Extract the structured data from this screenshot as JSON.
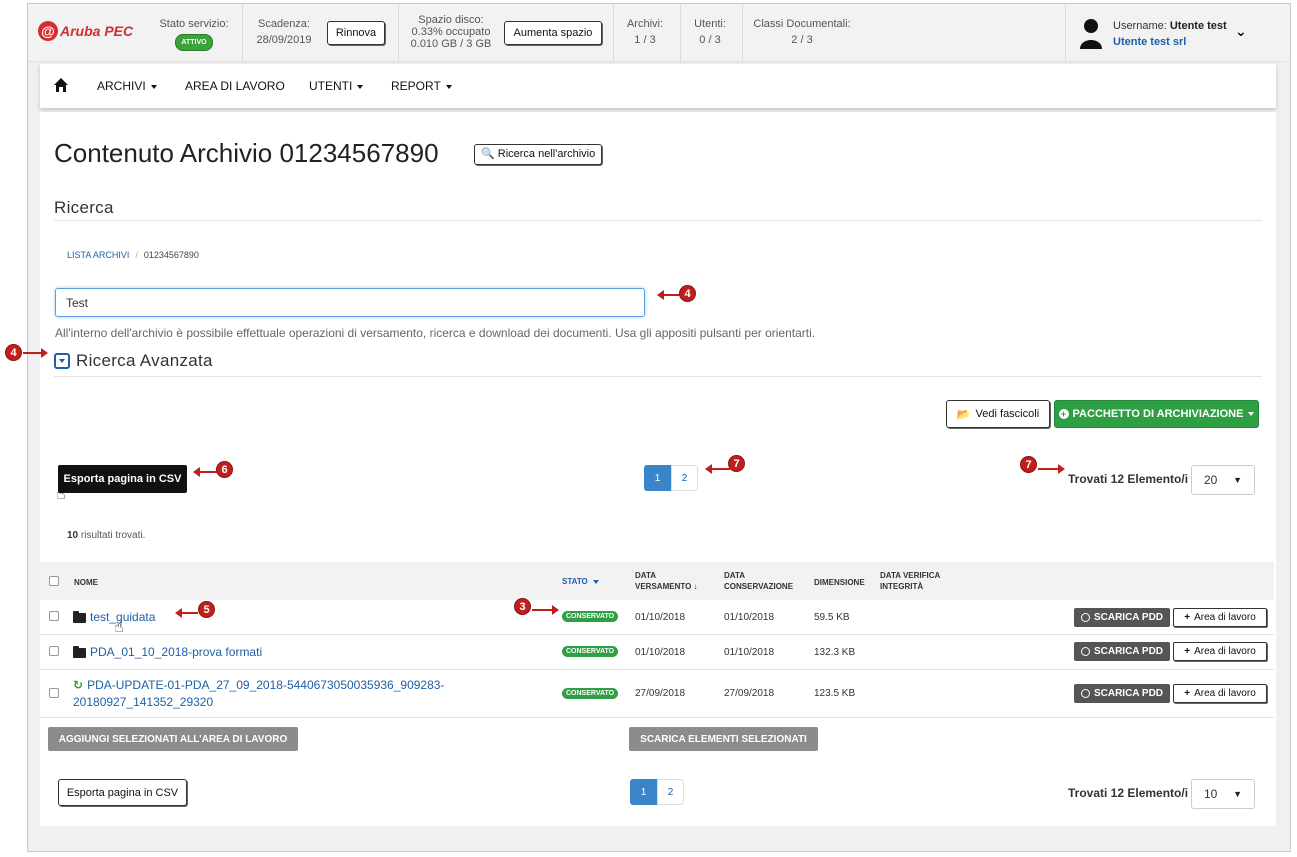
{
  "topbar": {
    "brand": "Aruba PEC",
    "service_status_label": "Stato servizio:",
    "service_status_badge": "ATTIVO",
    "expiry_label": "Scadenza:",
    "expiry_date": "28/09/2019",
    "renew_button": "Rinnova",
    "disk_label": "Spazio disco:",
    "disk_percent": "0.33% occupato",
    "disk_usage": "0.010 GB / 3 GB",
    "increase_space_button": "Aumenta spazio",
    "archives_label": "Archivi:",
    "archives_value": "1 / 3",
    "users_label": "Utenti:",
    "users_value": "0 / 3",
    "classes_label": "Classi Documentali:",
    "classes_value": "2 / 3",
    "username_label": "Username:",
    "username_value": "Utente test",
    "company": "Utente test srl"
  },
  "nav": {
    "items": [
      "ARCHIVI",
      "AREA DI LAVORO",
      "UTENTI",
      "REPORT"
    ]
  },
  "main": {
    "title": "Contenuto Archivio 01234567890",
    "search_archive_button": "Ricerca nell'archivio",
    "section_title": "Ricerca",
    "breadcrumb": [
      "LISTA ARCHIVI",
      "01234567890"
    ],
    "search_value": "Test",
    "help_text": "All'interno dell'archivio è possibile effettuale operazioni di versamento, ricerca e download dei documenti. Usa gli appositi pulsanti per orientarti.",
    "advanced_title": "Ricerca Avanzata",
    "vedi_fascicoli_button": "Vedi fascicoli",
    "pacchetto_button": "PACCHETTO DI ARCHIVIAZIONE",
    "export_csv_button": "Esporta pagina in CSV",
    "pages": [
      "1",
      "2"
    ],
    "found_text": "Trovati 12 Elemento/i",
    "page_size_top": "20",
    "page_size_bottom": "10",
    "results_count": "10",
    "results_text": " risultati trovati.",
    "add_selected_button": "AGGIUNGI SELEZIONATI ALL'AREA DI LAVORO",
    "download_selected_button": "SCARICA ELEMENTI SELEZIONATI"
  },
  "table": {
    "headers": {
      "name": "NOME",
      "status": "STATO",
      "data_versamento": "DATA VERSAMENTO",
      "data_conservazione": "DATA CONSERVAZIONE",
      "dimensione": "DIMENSIONE",
      "data_verifica": "DATA VERIFICA INTEGRITÀ"
    },
    "rows": [
      {
        "name": "test_guidata",
        "status": "CONSERVATO",
        "versamento": "01/10/2018",
        "conservazione": "01/10/2018",
        "size": "59.5 KB",
        "scarica": "SCARICA PDD",
        "area": "Area di lavoro"
      },
      {
        "name": "PDA_01_10_2018-prova formati",
        "status": "CONSERVATO",
        "versamento": "01/10/2018",
        "conservazione": "01/10/2018",
        "size": "132.3 KB",
        "scarica": "SCARICA PDD",
        "area": "Area di lavoro"
      },
      {
        "name": "PDA-UPDATE-01-PDA_27_09_2018-5440673050035936_909283-20180927_141352_29320",
        "status": "CONSERVATO",
        "versamento": "27/09/2018",
        "conservazione": "27/09/2018",
        "size": "123.5 KB",
        "scarica": "SCARICA PDD",
        "area": "Area di lavoro"
      }
    ]
  },
  "annotations": [
    "4",
    "4",
    "6",
    "7",
    "7",
    "3",
    "5"
  ],
  "colors": {
    "accent": "#1f5fa8",
    "green": "#2ea043",
    "annotation": "#c0201c"
  }
}
